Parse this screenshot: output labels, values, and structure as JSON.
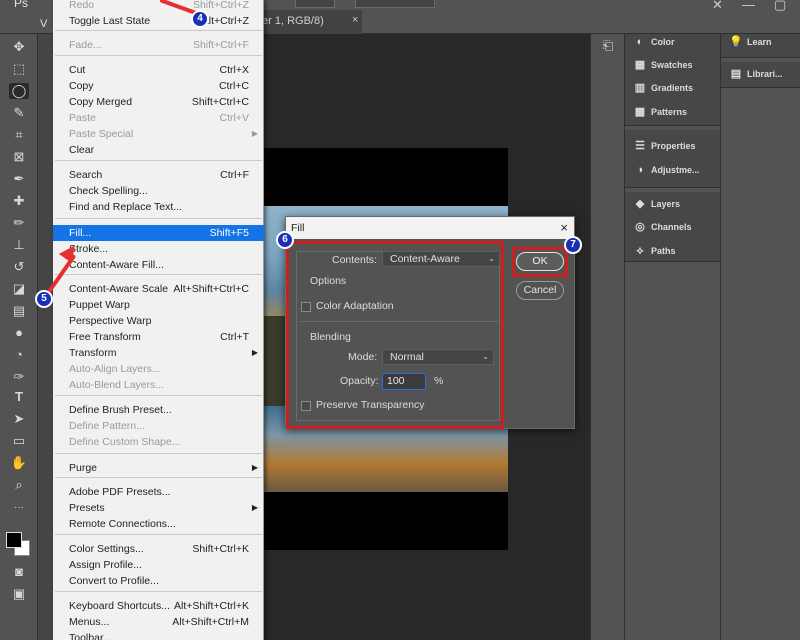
{
  "top": {
    "doc_tab": "er 1, RGB/8)",
    "tab_close": "×",
    "left_letter": "V",
    "ps_logo": "Ps"
  },
  "menu": {
    "items": [
      {
        "label": "Redo",
        "shortcut": "Shift+Ctrl+Z",
        "disabled": true
      },
      {
        "label": "Toggle Last State",
        "shortcut": "Alt+Ctrl+Z"
      },
      {
        "label": "Fade...",
        "shortcut": "Shift+Ctrl+F",
        "disabled": true
      },
      {
        "label": "Cut",
        "shortcut": "Ctrl+X"
      },
      {
        "label": "Copy",
        "shortcut": "Ctrl+C"
      },
      {
        "label": "Copy Merged",
        "shortcut": "Shift+Ctrl+C"
      },
      {
        "label": "Paste",
        "shortcut": "Ctrl+V",
        "disabled": true
      },
      {
        "label": "Paste Special",
        "shortcut": "",
        "disabled": true,
        "submenu": true
      },
      {
        "label": "Clear",
        "shortcut": ""
      },
      {
        "label": "Search",
        "shortcut": "Ctrl+F"
      },
      {
        "label": "Check Spelling...",
        "shortcut": ""
      },
      {
        "label": "Find and Replace Text...",
        "shortcut": ""
      },
      {
        "label": "Fill...",
        "shortcut": "Shift+F5",
        "selected": true
      },
      {
        "label": "Stroke...",
        "shortcut": ""
      },
      {
        "label": "Content-Aware Fill...",
        "shortcut": ""
      },
      {
        "label": "Content-Aware Scale",
        "shortcut": "Alt+Shift+Ctrl+C"
      },
      {
        "label": "Puppet Warp",
        "shortcut": ""
      },
      {
        "label": "Perspective Warp",
        "shortcut": ""
      },
      {
        "label": "Free Transform",
        "shortcut": "Ctrl+T"
      },
      {
        "label": "Transform",
        "shortcut": "",
        "submenu": true
      },
      {
        "label": "Auto-Align Layers...",
        "shortcut": "",
        "disabled": true
      },
      {
        "label": "Auto-Blend Layers...",
        "shortcut": "",
        "disabled": true
      },
      {
        "label": "Define Brush Preset...",
        "shortcut": ""
      },
      {
        "label": "Define Pattern...",
        "shortcut": "",
        "disabled": true
      },
      {
        "label": "Define Custom Shape...",
        "shortcut": "",
        "disabled": true
      },
      {
        "label": "Purge",
        "shortcut": "",
        "submenu": true
      },
      {
        "label": "Adobe PDF Presets...",
        "shortcut": ""
      },
      {
        "label": "Presets",
        "shortcut": "",
        "submenu": true
      },
      {
        "label": "Remote Connections...",
        "shortcut": ""
      },
      {
        "label": "Color Settings...",
        "shortcut": "Shift+Ctrl+K"
      },
      {
        "label": "Assign Profile...",
        "shortcut": ""
      },
      {
        "label": "Convert to Profile...",
        "shortcut": ""
      },
      {
        "label": "Keyboard Shortcuts...",
        "shortcut": "Alt+Shift+Ctrl+K"
      },
      {
        "label": "Menus...",
        "shortcut": "Alt+Shift+Ctrl+M"
      },
      {
        "label": "Toolbar...",
        "shortcut": ""
      }
    ]
  },
  "panels": {
    "col2": [
      {
        "label": "Color",
        "icon": "color-icon"
      },
      {
        "label": "Swatches",
        "icon": "swatches-icon"
      },
      {
        "label": "Gradients",
        "icon": "gradients-icon"
      },
      {
        "label": "Patterns",
        "icon": "patterns-icon"
      },
      {
        "label": "Properties",
        "icon": "properties-icon"
      },
      {
        "label": "Adjustme...",
        "icon": "adjustments-icon"
      },
      {
        "label": "Layers",
        "icon": "layers-icon"
      },
      {
        "label": "Channels",
        "icon": "channels-icon"
      },
      {
        "label": "Paths",
        "icon": "paths-icon"
      }
    ],
    "col3": [
      {
        "label": "Learn",
        "icon": "learn-icon"
      },
      {
        "label": "Librari...",
        "icon": "libraries-icon"
      }
    ]
  },
  "dialog": {
    "title": "Fill",
    "close": "×",
    "contents_label": "Contents:",
    "contents_value": "Content-Aware",
    "options_label": "Options",
    "color_adaptation_label": "Color Adaptation",
    "color_adaptation_checked": false,
    "blending_label": "Blending",
    "mode_label": "Mode:",
    "mode_value": "Normal",
    "opacity_label": "Opacity:",
    "opacity_value": "100",
    "opacity_unit": "%",
    "preserve_transparency_label": "Preserve Transparency",
    "preserve_transparency_checked": false,
    "ok_label": "OK",
    "cancel_label": "Cancel"
  },
  "annotations": {
    "step4": "4",
    "step5": "5",
    "step6": "6",
    "step7": "7",
    "highlight_color": "#d01e1e",
    "badge_color": "#1a2fb5"
  }
}
